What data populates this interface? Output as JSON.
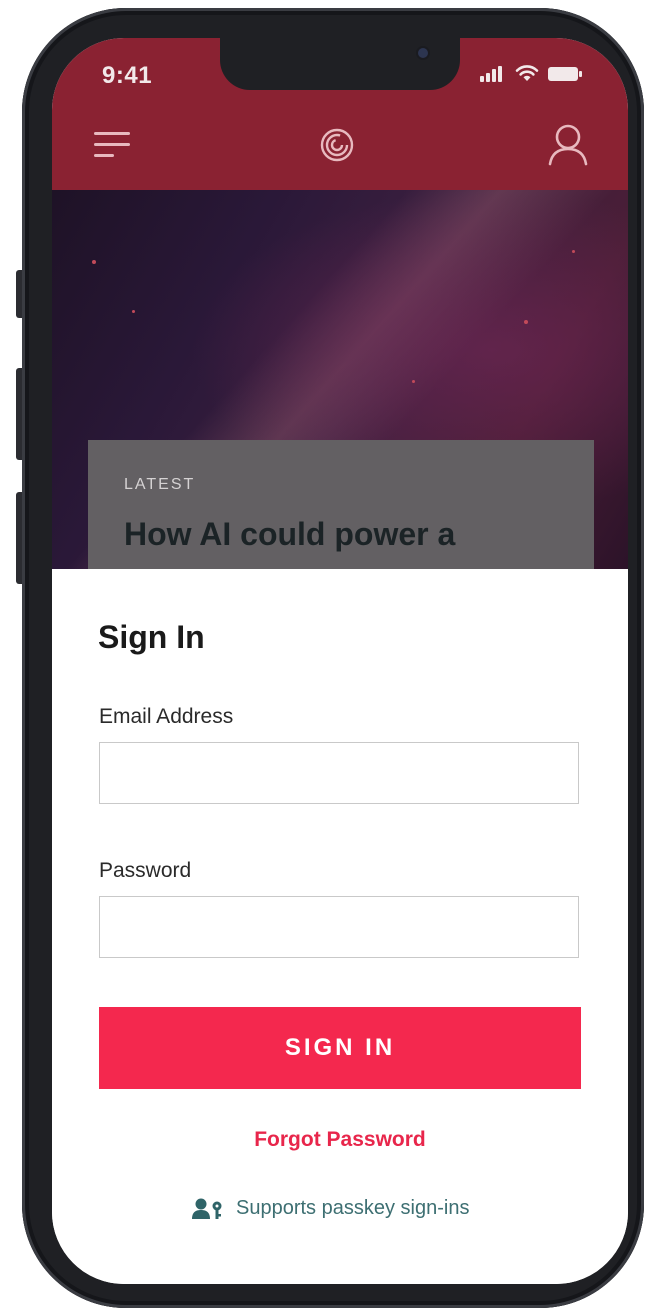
{
  "status_bar": {
    "time": "9:41"
  },
  "header": {
    "menu_icon": "hamburger-menu-icon",
    "logo_icon": "spiral-logo-icon",
    "profile_icon": "user-profile-icon",
    "color": "#8a2232"
  },
  "hero": {
    "kicker": "LATEST",
    "headline": "How AI could power a"
  },
  "signin": {
    "title": "Sign In",
    "email_label": "Email Address",
    "email_value": "",
    "password_label": "Password",
    "password_value": "",
    "button_label": "SIGN IN",
    "forgot_label": "Forgot Password",
    "passkey_label": "Supports passkey sign-ins",
    "passkey_icon": "user-key-icon",
    "accent_color": "#f4284e"
  }
}
